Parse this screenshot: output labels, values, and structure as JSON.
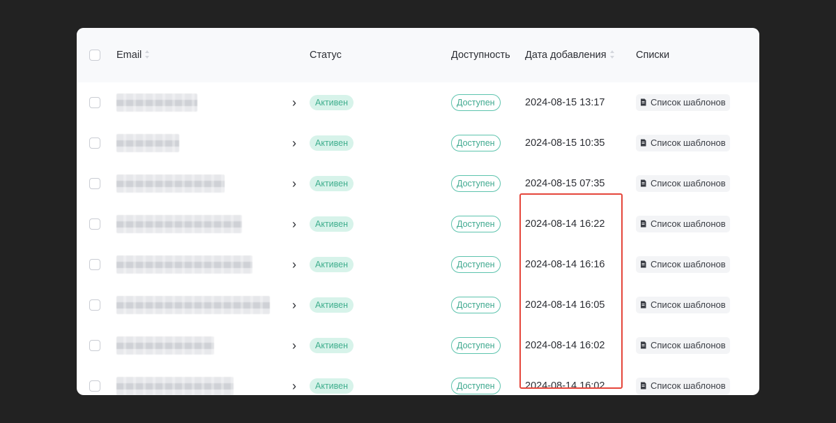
{
  "table": {
    "headers": {
      "email": "Email",
      "status": "Статус",
      "availability": "Доступность",
      "date_added": "Дата добавления",
      "lists": "Списки"
    },
    "rows": [
      {
        "status": "Активен",
        "availability": "Доступен",
        "date": "2024-08-15 13:17",
        "list": "Список шаблонов"
      },
      {
        "status": "Активен",
        "availability": "Доступен",
        "date": "2024-08-15 10:35",
        "list": "Список шаблонов"
      },
      {
        "status": "Активен",
        "availability": "Доступен",
        "date": "2024-08-15 07:35",
        "list": "Список шаблонов"
      },
      {
        "status": "Активен",
        "availability": "Доступен",
        "date": "2024-08-14 16:22",
        "list": "Список шаблонов"
      },
      {
        "status": "Активен",
        "availability": "Доступен",
        "date": "2024-08-14 16:16",
        "list": "Список шаблонов"
      },
      {
        "status": "Активен",
        "availability": "Доступен",
        "date": "2024-08-14 16:05",
        "list": "Список шаблонов"
      },
      {
        "status": "Активен",
        "availability": "Доступен",
        "date": "2024-08-14 16:02",
        "list": "Список шаблонов"
      },
      {
        "status": "Активен",
        "availability": "Доступен",
        "date": "2024-08-14 16:02",
        "list": "Список шаблонов"
      }
    ]
  },
  "icons": {
    "row_expand": "chevron-right-icon",
    "list": "document-icon",
    "sort": "sort-icon"
  },
  "colors": {
    "status_bg": "#d7f3ea",
    "status_text": "#3fae8d",
    "availability_border": "#5cc3ad",
    "highlight": "#e5453a",
    "background": "#222222"
  }
}
